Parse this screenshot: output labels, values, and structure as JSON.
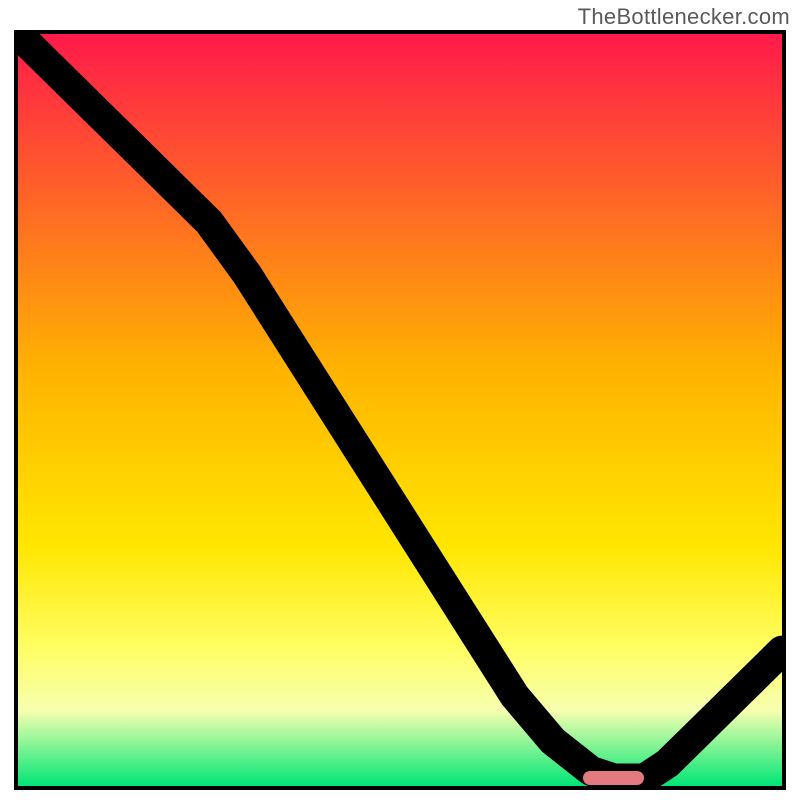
{
  "attribution": "TheBottlenecker.com",
  "chart_data": {
    "type": "line",
    "title": "",
    "xlabel": "",
    "ylabel": "",
    "xlim": [
      0,
      100
    ],
    "ylim": [
      0,
      100
    ],
    "series": [
      {
        "name": "bottleneck-curve",
        "x": [
          0,
          5,
          10,
          15,
          20,
          25,
          30,
          35,
          40,
          45,
          50,
          55,
          60,
          65,
          70,
          75,
          78,
          80,
          82,
          85,
          90,
          95,
          100
        ],
        "y": [
          100,
          95,
          90,
          85,
          80,
          75,
          68,
          60,
          52,
          44,
          36,
          28,
          20,
          12,
          6,
          2,
          1,
          1,
          1,
          3,
          8,
          13,
          18
        ]
      }
    ],
    "marker": {
      "x_center": 78,
      "x_width": 8,
      "y": 1
    },
    "gradient_stops": [
      {
        "pct": 0,
        "color": "#ff1a4b"
      },
      {
        "pct": 45,
        "color": "#ffb400"
      },
      {
        "pct": 68,
        "color": "#ffe600"
      },
      {
        "pct": 82,
        "color": "#ffff66"
      },
      {
        "pct": 90,
        "color": "#f6ffb0"
      },
      {
        "pct": 100,
        "color": "#00e676"
      }
    ]
  }
}
